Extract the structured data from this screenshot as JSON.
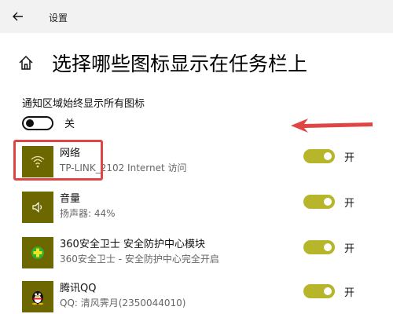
{
  "window": {
    "title": "设置"
  },
  "page": {
    "title": "选择哪些图标显示在任务栏上"
  },
  "master": {
    "label": "通知区域始终显示所有图标",
    "state": "关"
  },
  "items": [
    {
      "name": "网络",
      "desc": "TP-LINK_2102 Internet 访问",
      "state": "开",
      "icon": "wifi-icon"
    },
    {
      "name": "音量",
      "desc": "扬声器: 44%",
      "state": "开",
      "icon": "speaker-icon"
    },
    {
      "name": "360安全卫士 安全防护中心模块",
      "desc": "360安全卫士 - 安全防护中心完全开启",
      "state": "开",
      "icon": "shield-plus-icon"
    },
    {
      "name": "腾讯QQ",
      "desc": "QQ: 清风霁月(2350044010)",
      "state": "开",
      "icon": "qq-penguin-icon"
    }
  ],
  "colors": {
    "accent": "#b7b52a",
    "icon_bg": "#6d6700",
    "annotation": "#e04545"
  }
}
